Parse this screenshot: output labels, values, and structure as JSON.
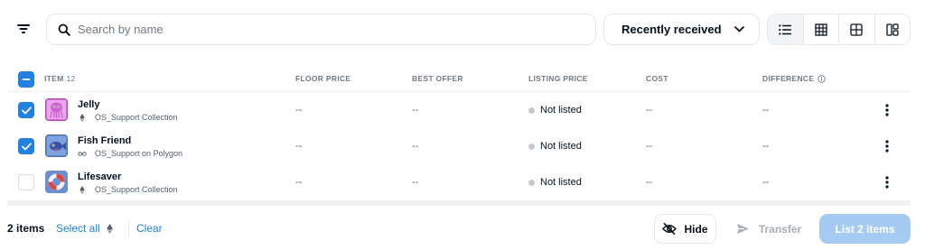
{
  "toolbar": {
    "search_placeholder": "Search by name",
    "sort_label": "Recently received",
    "views": [
      "list-view-icon",
      "grid-large-icon",
      "grid-small-icon",
      "compact-icon"
    ]
  },
  "table": {
    "columns": {
      "item": "ITEM",
      "item_count": "12",
      "floor_price": "FLOOR PRICE",
      "best_offer": "BEST OFFER",
      "listing_price": "LISTING PRICE",
      "cost": "COST",
      "difference": "DIFFERENCE"
    },
    "rows": [
      {
        "name": "Jelly",
        "collection": "OS_Support Collection",
        "chain_icon": "ethereum-icon",
        "selected": true,
        "floor_price": "--",
        "best_offer": "--",
        "listing_price": "Not listed",
        "cost": "--",
        "difference": "--"
      },
      {
        "name": "Fish Friend",
        "collection": "OS_Support on Polygon",
        "chain_icon": "polygon-icon",
        "selected": true,
        "floor_price": "--",
        "best_offer": "--",
        "listing_price": "Not listed",
        "cost": "--",
        "difference": "--"
      },
      {
        "name": "Lifesaver",
        "collection": "OS_Support Collection",
        "chain_icon": "ethereum-icon",
        "selected": false,
        "floor_price": "--",
        "best_offer": "--",
        "listing_price": "Not listed",
        "cost": "--",
        "difference": "--"
      }
    ]
  },
  "bottom": {
    "count": "2 items",
    "select_all": "Select all",
    "clear": "Clear",
    "hide": "Hide",
    "transfer": "Transfer",
    "list": "List 2 items"
  },
  "colors": {
    "accent": "#2081e2",
    "list_button": "#a6cbf3",
    "muted": "#707a83"
  }
}
